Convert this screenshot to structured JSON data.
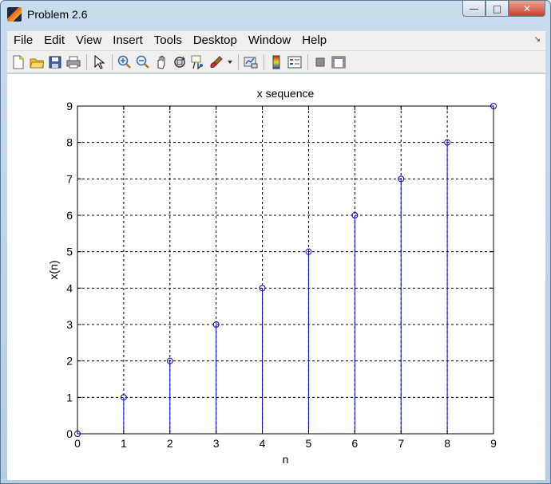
{
  "window": {
    "title": "Problem 2.6"
  },
  "menus": [
    "File",
    "Edit",
    "View",
    "Insert",
    "Tools",
    "Desktop",
    "Window",
    "Help"
  ],
  "toolbar": {
    "icons": [
      "new-figure-icon",
      "open-file-icon",
      "save-icon",
      "print-icon",
      "pointer-icon",
      "zoom-in-icon",
      "zoom-out-icon",
      "pan-icon",
      "rotate-3d-icon",
      "data-cursor-icon",
      "brush-icon",
      "link-plot-icon",
      "colorbar-icon",
      "legend-icon",
      "hide-plot-tools-icon",
      "show-plot-tools-icon"
    ]
  },
  "chart_data": {
    "type": "stem",
    "title": "x sequence",
    "xlabel": "n",
    "ylabel": "x(n)",
    "x": [
      0,
      1,
      2,
      3,
      4,
      5,
      6,
      7,
      8,
      9
    ],
    "y": [
      0,
      1,
      2,
      3,
      4,
      5,
      6,
      7,
      8,
      9
    ],
    "xlim": [
      0,
      9
    ],
    "ylim": [
      0,
      9
    ],
    "xticks": [
      "0",
      "1",
      "2",
      "3",
      "4",
      "5",
      "6",
      "7",
      "8",
      "9"
    ],
    "yticks": [
      "0",
      "1",
      "2",
      "3",
      "4",
      "5",
      "6",
      "7",
      "8",
      "9"
    ],
    "grid": true,
    "marker": "circle",
    "color": "#0000ff"
  }
}
